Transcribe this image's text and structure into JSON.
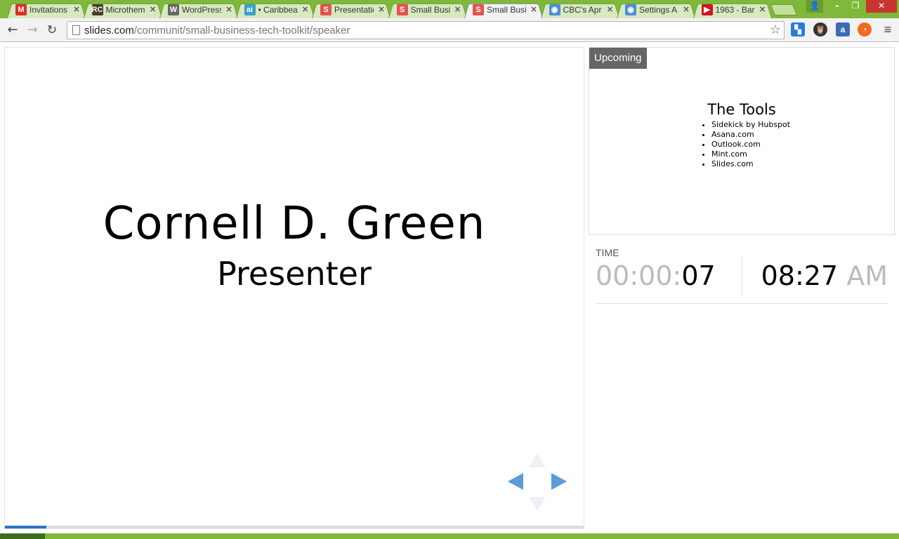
{
  "browser": {
    "tabs": [
      {
        "title": "Invitations",
        "favicon": "gmail-icon",
        "fav_text": "M",
        "fav_color": "#d93025",
        "active": false
      },
      {
        "title": "Microthemes",
        "favicon": "runcms-icon",
        "fav_text": "RC",
        "fav_color": "#4a3b2a",
        "active": false
      },
      {
        "title": "WordPress",
        "favicon": "wordpress-icon",
        "fav_text": "W",
        "fav_color": "#666666",
        "active": false
      },
      {
        "title": "• Caribbean",
        "favicon": "ai-icon",
        "fav_text": "ai",
        "fav_color": "#3aa0c8",
        "active": false
      },
      {
        "title": "Presentations",
        "favicon": "slides-icon",
        "fav_text": "S",
        "fav_color": "#e5534b",
        "active": false
      },
      {
        "title": "Small Business",
        "favicon": "slides-icon",
        "fav_text": "S",
        "fav_color": "#e5534b",
        "active": false
      },
      {
        "title": "Small Business",
        "favicon": "slides-icon",
        "fav_text": "S",
        "fav_color": "#e5534b",
        "active": true
      },
      {
        "title": "CBC's Apr",
        "favicon": "chrome-icon",
        "fav_text": "◉",
        "fav_color": "#4a8fd4",
        "active": false
      },
      {
        "title": "Settings A",
        "favicon": "chrome-icon",
        "fav_text": "◉",
        "fav_color": "#4a8fd4",
        "active": false
      },
      {
        "title": "1963 - Bar",
        "favicon": "youtube-icon",
        "fav_text": "▶",
        "fav_color": "#cc181e",
        "active": false
      }
    ],
    "tab_close": "×",
    "window_buttons": {
      "profile": "👤",
      "minimize": "–",
      "maximize": "❐",
      "close": "✕"
    },
    "toolbar": {
      "back": "←",
      "forward": "→",
      "reload": "↻"
    },
    "url": {
      "host": "slides.com",
      "path": "/communit/small-business-tech-toolkit/speaker"
    },
    "star": "☆",
    "extensions": [
      "▚",
      "🦉",
      "a",
      "◔"
    ],
    "menu": "≡"
  },
  "slide": {
    "name": "Cornell D. Green",
    "role": "Presenter",
    "progress": 0.072
  },
  "upcoming": {
    "label": "Upcoming",
    "title": "The Tools",
    "items": [
      "Sidekick by Hubspot",
      "Asana.com",
      "Outlook.com",
      "Mint.com",
      "Slides.com"
    ]
  },
  "timer": {
    "label": "TIME",
    "elapsed_dim": "00:00:",
    "elapsed_seconds": "07",
    "clock_time": "08:27",
    "clock_ampm": "AM"
  },
  "colors": {
    "accent": "#2a74c4",
    "nav_arrows": "#5b9bd8",
    "chrome_frame": "#7fb83a"
  }
}
